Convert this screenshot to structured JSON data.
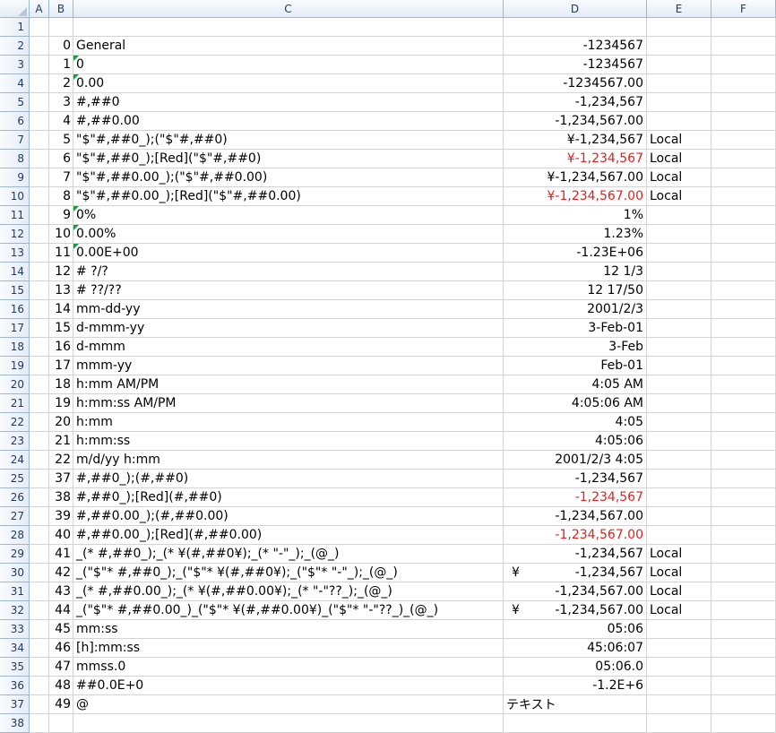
{
  "columns": [
    "A",
    "B",
    "C",
    "D",
    "E",
    "F"
  ],
  "rows": [
    {
      "num": "1",
      "b": "",
      "c": "",
      "d": "",
      "e": "",
      "red": false,
      "flag": false,
      "yen": ""
    },
    {
      "num": "2",
      "b": "0",
      "c": "General",
      "d": "-1234567",
      "e": "",
      "red": false,
      "flag": false,
      "yen": ""
    },
    {
      "num": "3",
      "b": "1",
      "c": "0",
      "d": "-1234567",
      "e": "",
      "red": false,
      "flag": true,
      "yen": ""
    },
    {
      "num": "4",
      "b": "2",
      "c": "0.00",
      "d": "-1234567.00",
      "e": "",
      "red": false,
      "flag": true,
      "yen": ""
    },
    {
      "num": "5",
      "b": "3",
      "c": "#,##0",
      "d": "-1,234,567",
      "e": "",
      "red": false,
      "flag": false,
      "yen": ""
    },
    {
      "num": "6",
      "b": "4",
      "c": "#,##0.00",
      "d": "-1,234,567.00",
      "e": "",
      "red": false,
      "flag": false,
      "yen": ""
    },
    {
      "num": "7",
      "b": "5",
      "c": "\"$\"#,##0_);(\"$\"#,##0)",
      "d": "¥-1,234,567",
      "e": "Local",
      "red": false,
      "flag": false,
      "yen": ""
    },
    {
      "num": "8",
      "b": "6",
      "c": "\"$\"#,##0_);[Red](\"$\"#,##0)",
      "d": "¥-1,234,567",
      "e": "Local",
      "red": true,
      "flag": false,
      "yen": ""
    },
    {
      "num": "9",
      "b": "7",
      "c": "\"$\"#,##0.00_);(\"$\"#,##0.00)",
      "d": "¥-1,234,567.00",
      "e": "Local",
      "red": false,
      "flag": false,
      "yen": ""
    },
    {
      "num": "10",
      "b": "8",
      "c": "\"$\"#,##0.00_);[Red](\"$\"#,##0.00)",
      "d": "¥-1,234,567.00",
      "e": "Local",
      "red": true,
      "flag": false,
      "yen": ""
    },
    {
      "num": "11",
      "b": "9",
      "c": "0%",
      "d": "1%",
      "e": "",
      "red": false,
      "flag": true,
      "yen": ""
    },
    {
      "num": "12",
      "b": "10",
      "c": "0.00%",
      "d": "1.23%",
      "e": "",
      "red": false,
      "flag": true,
      "yen": ""
    },
    {
      "num": "13",
      "b": "11",
      "c": "0.00E+00",
      "d": "-1.23E+06",
      "e": "",
      "red": false,
      "flag": true,
      "yen": ""
    },
    {
      "num": "14",
      "b": "12",
      "c": "# ?/?",
      "d": "12 1/3",
      "e": "",
      "red": false,
      "flag": false,
      "yen": ""
    },
    {
      "num": "15",
      "b": "13",
      "c": "# ??/??",
      "d": "12 17/50",
      "e": "",
      "red": false,
      "flag": false,
      "yen": ""
    },
    {
      "num": "16",
      "b": "14",
      "c": "mm-dd-yy",
      "d": "2001/2/3",
      "e": "",
      "red": false,
      "flag": false,
      "yen": ""
    },
    {
      "num": "17",
      "b": "15",
      "c": "d-mmm-yy",
      "d": "3-Feb-01",
      "e": "",
      "red": false,
      "flag": false,
      "yen": ""
    },
    {
      "num": "18",
      "b": "16",
      "c": "d-mmm",
      "d": "3-Feb",
      "e": "",
      "red": false,
      "flag": false,
      "yen": ""
    },
    {
      "num": "19",
      "b": "17",
      "c": "mmm-yy",
      "d": "Feb-01",
      "e": "",
      "red": false,
      "flag": false,
      "yen": ""
    },
    {
      "num": "20",
      "b": "18",
      "c": "h:mm AM/PM",
      "d": "4:05 AM",
      "e": "",
      "red": false,
      "flag": false,
      "yen": ""
    },
    {
      "num": "21",
      "b": "19",
      "c": "h:mm:ss AM/PM",
      "d": "4:05:06 AM",
      "e": "",
      "red": false,
      "flag": false,
      "yen": ""
    },
    {
      "num": "22",
      "b": "20",
      "c": "h:mm",
      "d": "4:05",
      "e": "",
      "red": false,
      "flag": false,
      "yen": ""
    },
    {
      "num": "23",
      "b": "21",
      "c": "h:mm:ss",
      "d": "4:05:06",
      "e": "",
      "red": false,
      "flag": false,
      "yen": ""
    },
    {
      "num": "24",
      "b": "22",
      "c": "m/d/yy h:mm",
      "d": "2001/2/3 4:05",
      "e": "",
      "red": false,
      "flag": false,
      "yen": ""
    },
    {
      "num": "25",
      "b": "37",
      "c": "#,##0_);(#,##0)",
      "d": "-1,234,567",
      "e": "",
      "red": false,
      "flag": false,
      "yen": ""
    },
    {
      "num": "26",
      "b": "38",
      "c": "#,##0_);[Red](#,##0)",
      "d": "-1,234,567",
      "e": "",
      "red": true,
      "flag": false,
      "yen": ""
    },
    {
      "num": "27",
      "b": "39",
      "c": "#,##0.00_);(#,##0.00)",
      "d": "-1,234,567.00",
      "e": "",
      "red": false,
      "flag": false,
      "yen": ""
    },
    {
      "num": "28",
      "b": "40",
      "c": "#,##0.00_);[Red](#,##0.00)",
      "d": "-1,234,567.00",
      "e": "",
      "red": true,
      "flag": false,
      "yen": ""
    },
    {
      "num": "29",
      "b": "41",
      "c": "_(* #,##0_);_(* ¥(#,##0¥);_(* \"-\"_);_(@_)",
      "d": "-1,234,567",
      "e": "Local",
      "red": false,
      "flag": false,
      "yen": ""
    },
    {
      "num": "30",
      "b": "42",
      "c": "_(\"$\"* #,##0_);_(\"$\"* ¥(#,##0¥);_(\"$\"* \"-\"_);_(@_)",
      "d": "-1,234,567",
      "e": "Local",
      "red": false,
      "flag": false,
      "yen": "¥"
    },
    {
      "num": "31",
      "b": "43",
      "c": "_(* #,##0.00_);_(* ¥(#,##0.00¥);_(* \"-\"??_);_(@_)",
      "d": "-1,234,567.00",
      "e": "Local",
      "red": false,
      "flag": false,
      "yen": ""
    },
    {
      "num": "32",
      "b": "44",
      "c": "_(\"$\"* #,##0.00_)_(\"$\"* ¥(#,##0.00¥)_(\"$\"* \"-\"??_)_(@_)",
      "d": "-1,234,567.00",
      "e": "Local",
      "red": false,
      "flag": false,
      "yen": "¥"
    },
    {
      "num": "33",
      "b": "45",
      "c": "mm:ss",
      "d": "05:06",
      "e": "",
      "red": false,
      "flag": false,
      "yen": ""
    },
    {
      "num": "34",
      "b": "46",
      "c": "[h]:mm:ss",
      "d": "45:06:07",
      "e": "",
      "red": false,
      "flag": false,
      "yen": ""
    },
    {
      "num": "35",
      "b": "47",
      "c": "mmss.0",
      "d": "05:06.0",
      "e": "",
      "red": false,
      "flag": false,
      "yen": ""
    },
    {
      "num": "36",
      "b": "48",
      "c": "##0.0E+0",
      "d": "-1.2E+6",
      "e": "",
      "red": false,
      "flag": false,
      "yen": ""
    },
    {
      "num": "37",
      "b": "49",
      "c": "@",
      "d": "テキスト",
      "e": "",
      "red": false,
      "flag": false,
      "yen": "",
      "left": true
    },
    {
      "num": "38",
      "b": "",
      "c": "",
      "d": "",
      "e": "",
      "red": false,
      "flag": false,
      "yen": ""
    }
  ],
  "colors": {
    "red_text": "#e02020",
    "header_bg": "#e4ecf7",
    "gridline": "#d4d4d4",
    "error_flag": "#1a9a3c"
  }
}
